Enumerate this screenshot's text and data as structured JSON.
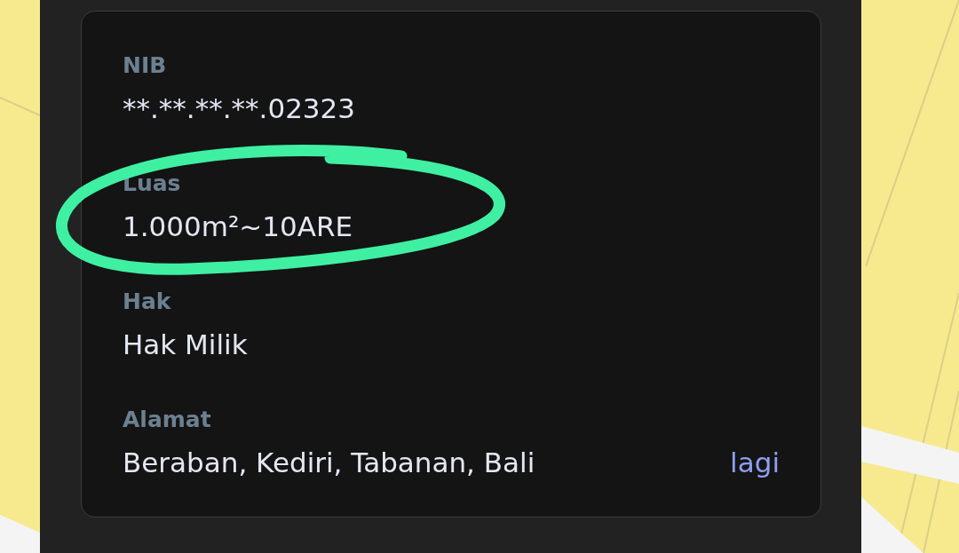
{
  "fields": [
    {
      "label": "NIB",
      "value": "**.**.**.**.02323",
      "circled": false
    },
    {
      "label": "Luas",
      "value": "1.000m²~10ARE",
      "circled": true
    },
    {
      "label": "Hak",
      "value": "Hak Milik",
      "circled": false
    },
    {
      "label": "Alamat",
      "value": "Beraban, Kediri, Tabanan, Bali",
      "circled": false,
      "link": "lagi"
    }
  ]
}
